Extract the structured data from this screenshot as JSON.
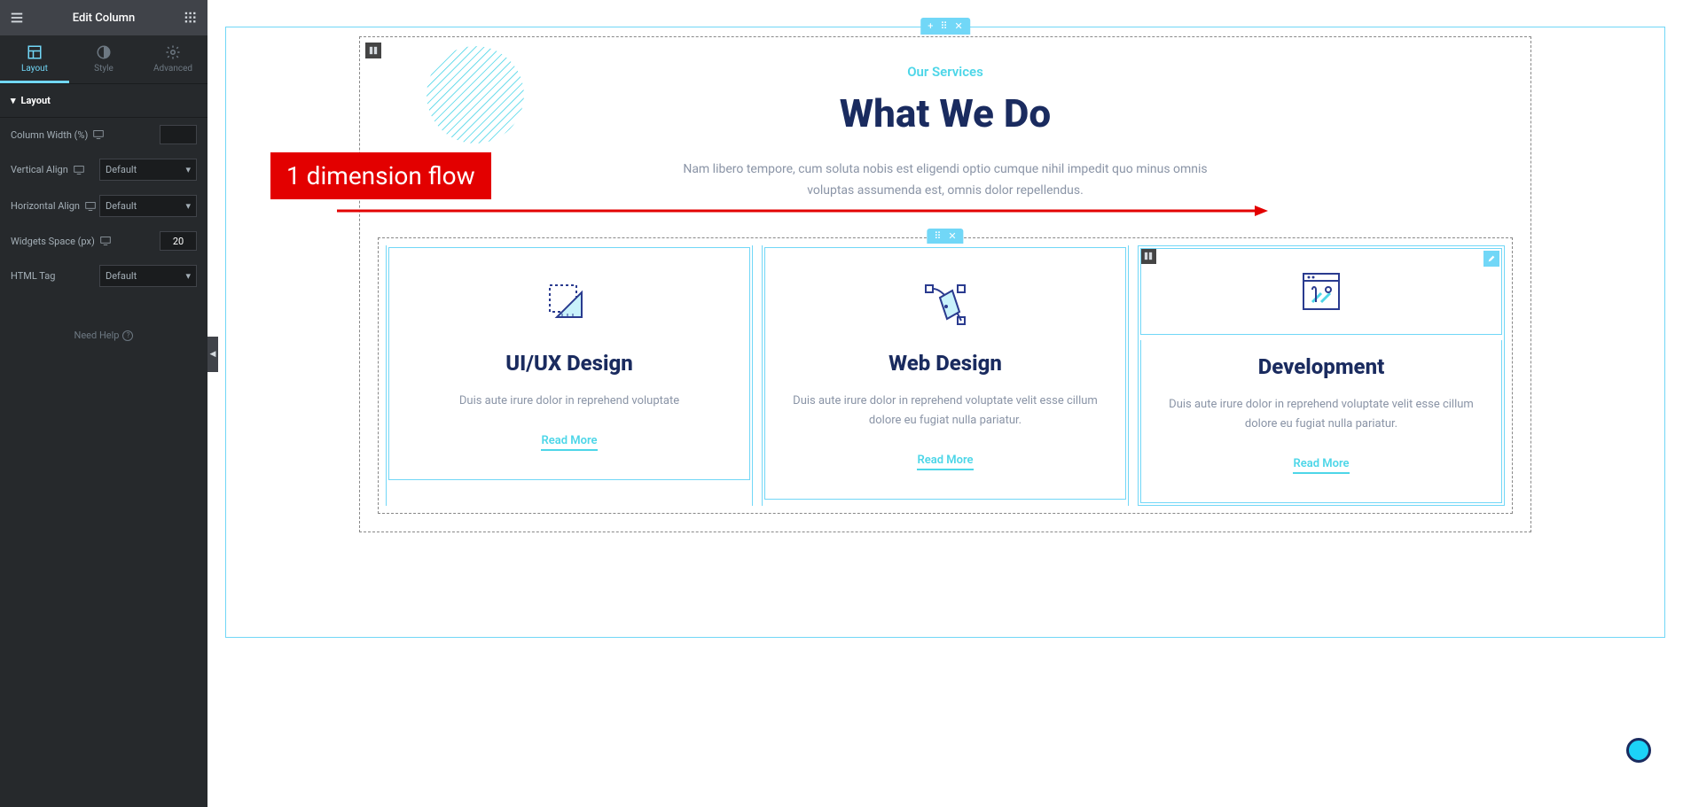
{
  "sidebar": {
    "title": "Edit Column",
    "tabs": {
      "layout": "Layout",
      "style": "Style",
      "advanced": "Advanced"
    },
    "section_label": "Layout",
    "controls": {
      "column_width_label": "Column Width (%)",
      "column_width_value": "",
      "vertical_align_label": "Vertical Align",
      "vertical_align_value": "Default",
      "horizontal_align_label": "Horizontal Align",
      "horizontal_align_value": "Default",
      "widgets_space_label": "Widgets Space (px)",
      "widgets_space_value": "20",
      "html_tag_label": "HTML Tag",
      "html_tag_value": "Default"
    },
    "need_help": "Need Help"
  },
  "annotation": {
    "label": "1 dimension flow"
  },
  "content": {
    "eyebrow": "Our Services",
    "headline": "What We Do",
    "lead": "Nam libero tempore, cum soluta nobis est eligendi optio cumque nihil impedit quo minus omnis voluptas assumenda est, omnis dolor repellendus.",
    "cards": [
      {
        "title": "UI/UX Design",
        "text": "Duis aute irure dolor in reprehend voluptate",
        "link": "Read More"
      },
      {
        "title": "Web Design",
        "text": "Duis aute irure dolor in reprehend voluptate velit esse cillum dolore eu fugiat nulla pariatur.",
        "link": "Read More"
      },
      {
        "title": "Development",
        "text": "Duis aute irure dolor in reprehend voluptate velit esse cillum dolore eu fugiat nulla pariatur.",
        "link": "Read More"
      }
    ]
  }
}
